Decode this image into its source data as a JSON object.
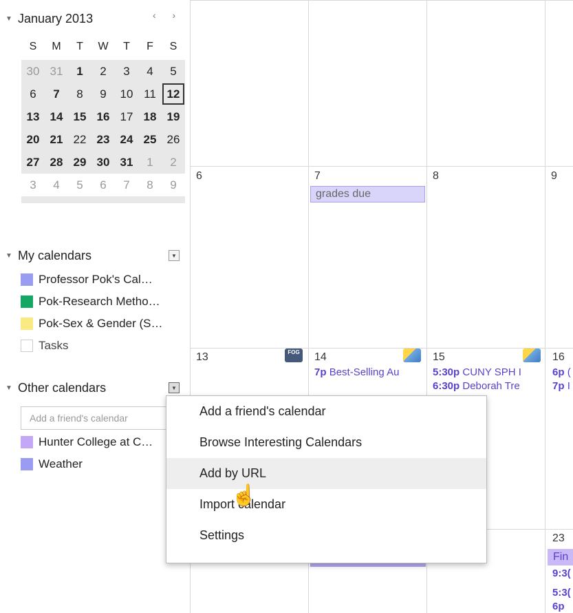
{
  "mini_calendar": {
    "title": "January 2013",
    "nav": "‹  ›",
    "weekdays": [
      "S",
      "M",
      "T",
      "W",
      "T",
      "F",
      "S"
    ],
    "weeks": [
      [
        "30",
        "31",
        "1",
        "2",
        "3",
        "4",
        "5"
      ],
      [
        "6",
        "7",
        "8",
        "9",
        "10",
        "11",
        "12"
      ],
      [
        "13",
        "14",
        "15",
        "16",
        "17",
        "18",
        "19"
      ],
      [
        "20",
        "21",
        "22",
        "23",
        "24",
        "25",
        "26"
      ],
      [
        "27",
        "28",
        "29",
        "30",
        "31",
        "1",
        "2"
      ],
      [
        "3",
        "4",
        "5",
        "6",
        "7",
        "8",
        "9"
      ]
    ]
  },
  "my_calendars": {
    "title": "My calendars",
    "items": [
      {
        "label": "Professor Pok's Cal…",
        "color": "#9a9cf2"
      },
      {
        "label": "Pok-Research Metho…",
        "color": "#16a765"
      },
      {
        "label": "Pok-Sex & Gender (S…",
        "color": "#fbe983"
      },
      {
        "label": "Tasks",
        "color": ""
      }
    ]
  },
  "other_calendars": {
    "title": "Other calendars",
    "input_placeholder": "Add a friend's calendar",
    "items": [
      {
        "label": "Hunter College at C…",
        "color": "#c5a8f5"
      },
      {
        "label": "Weather",
        "color": "#9a9cf2"
      }
    ]
  },
  "grid": {
    "row1_days": [
      "6",
      "7",
      "8",
      "9"
    ],
    "grades_due": "grades due",
    "row2_days": [
      "13",
      "14",
      "15",
      "16"
    ],
    "fog_label": "FOG",
    "events": {
      "d14_time": "7p",
      "d14_title": "Best-Selling Au",
      "d15a_time": "5:30p",
      "d15a_title": "CUNY SPH I",
      "d15b_time": "6:30p",
      "d15b_title": "Deborah Tre",
      "d16a_time": "6p",
      "d16a_title": "(",
      "d16b_time": "7p",
      "d16b_title": "I"
    },
    "row3_day": "23",
    "d23_allday": "Fin",
    "d23_time1": "9:3(",
    "d23_time2": "5:3(",
    "d23_time3": "6p"
  },
  "menu": {
    "items": [
      "Add a friend's calendar",
      "Browse Interesting Calendars",
      "Add by URL",
      "Import calendar",
      "Settings"
    ]
  },
  "cursor_glyph": "☝"
}
